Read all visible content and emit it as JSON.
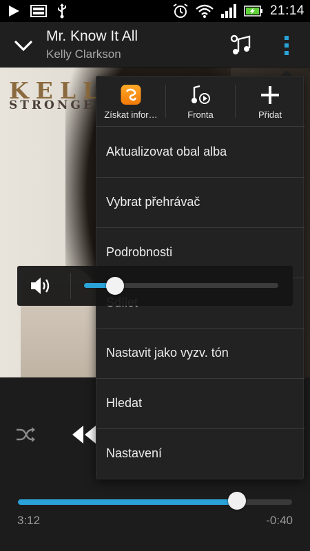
{
  "status_bar": {
    "time": "21:14",
    "left_icons": [
      "play-icon",
      "image-icon",
      "usb-icon"
    ],
    "right_icons": [
      "alarm-icon",
      "wifi-icon",
      "signal-icon",
      "battery-charging-icon"
    ],
    "battery_color": "#5fd13a"
  },
  "header": {
    "title": "Mr. Know It All",
    "artist": "Kelly Clarkson"
  },
  "album_art": {
    "title_text": "KELLY",
    "subtitle_text": "STRONGER"
  },
  "menu": {
    "quick_actions": [
      {
        "icon": "soundhound-icon",
        "label": "Získat infor…"
      },
      {
        "icon": "queue-icon",
        "label": "Fronta"
      },
      {
        "icon": "plus-icon",
        "label": "Přidat"
      }
    ],
    "items": [
      "Aktualizovat obal alba",
      "Vybrat přehrávač",
      "Podrobnosti",
      "Sdílet",
      "Nastavit jako vyzv. tón",
      "Hledat",
      "Nastavení"
    ]
  },
  "volume": {
    "level": 0.16,
    "accent": "#2aa3d8"
  },
  "player": {
    "current_time": "3:12",
    "remaining_time": "-0:40",
    "progress": 0.8,
    "accent": "#2aa3d8"
  }
}
